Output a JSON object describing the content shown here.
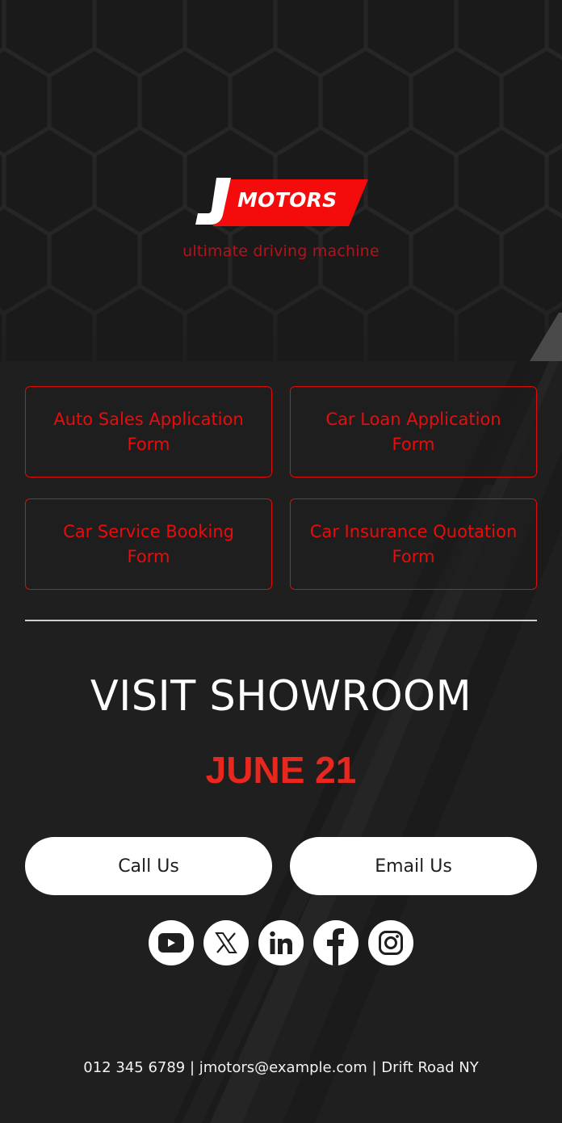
{
  "brand": {
    "logo_letter": "J",
    "logo_word": "MOTORS",
    "tagline": "ultimate driving machine"
  },
  "colors": {
    "accent_red": "#e00b0b",
    "date_red": "#e8271f",
    "tagline_red": "#b3141a",
    "background": "#1f1f1f",
    "button_white": "#ffffff"
  },
  "forms": [
    {
      "label": "Auto Sales Application Form",
      "icon": "none"
    },
    {
      "label": "Car Loan Application Form",
      "icon": "none"
    },
    {
      "label": "Car Service Booking Form",
      "icon": "none"
    },
    {
      "label": "Car Insurance Quotation Form",
      "icon": "none"
    }
  ],
  "event": {
    "title": "VISIT SHOWROOM",
    "date": "JUNE 21"
  },
  "cta": {
    "call_label": "Call Us",
    "email_label": "Email Us"
  },
  "social": [
    {
      "name": "YouTube",
      "icon": "youtube-icon"
    },
    {
      "name": "X",
      "icon": "x-icon"
    },
    {
      "name": "LinkedIn",
      "icon": "linkedin-icon"
    },
    {
      "name": "Facebook",
      "icon": "facebook-icon"
    },
    {
      "name": "Instagram",
      "icon": "instagram-icon"
    }
  ],
  "footer": {
    "contact_line": "012 345 6789 | jmotors@example.com | Drift Road NY"
  }
}
